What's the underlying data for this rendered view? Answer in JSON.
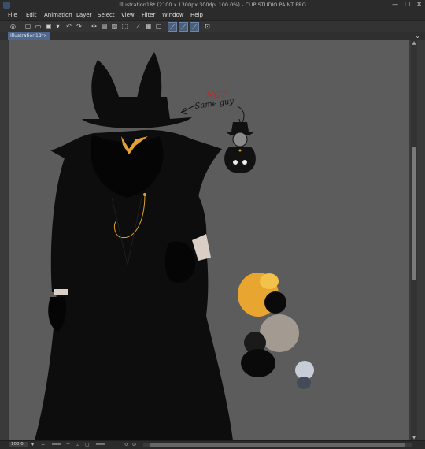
{
  "window": {
    "title": "Illustration18* (2100 x 1300px 300dpi 100.0%)  - CLIP STUDIO PAINT PRO",
    "min": "—",
    "max": "☐",
    "close": "✕"
  },
  "menu": [
    "File",
    "Edit",
    "Animation",
    "Layer",
    "Select",
    "View",
    "Filter",
    "Window",
    "Help"
  ],
  "toolbar": {
    "icons": [
      "app-icon",
      "new-icon",
      "open-icon",
      "save-icon",
      "export-icon",
      "undo-icon",
      "redo-icon",
      "clear-icon",
      "fill-icon",
      "transform-icon",
      "snap-ruler-icon",
      "snap-grid-icon",
      "snap-special-icon",
      "show-ruler-icon",
      "show-grid-icon",
      "perspective-icon"
    ]
  },
  "tab": {
    "label": "Illustration18*",
    "close": "×"
  },
  "artwork": {
    "annotation_word_red": "NOT",
    "annotation_text": "Same guy"
  },
  "status": {
    "zoom": "100.0"
  },
  "colors": {
    "canvas_bg": "#5c5c5c",
    "figure": "#0d0d0d",
    "gold": "#e3a22d",
    "annotation_red": "#d91c1c",
    "swatches": [
      "#e8a530",
      "#f2c24a",
      "#0a0a0a",
      "#a39a91",
      "#1a1a1a",
      "#c7ccd6",
      "#444a58"
    ]
  }
}
